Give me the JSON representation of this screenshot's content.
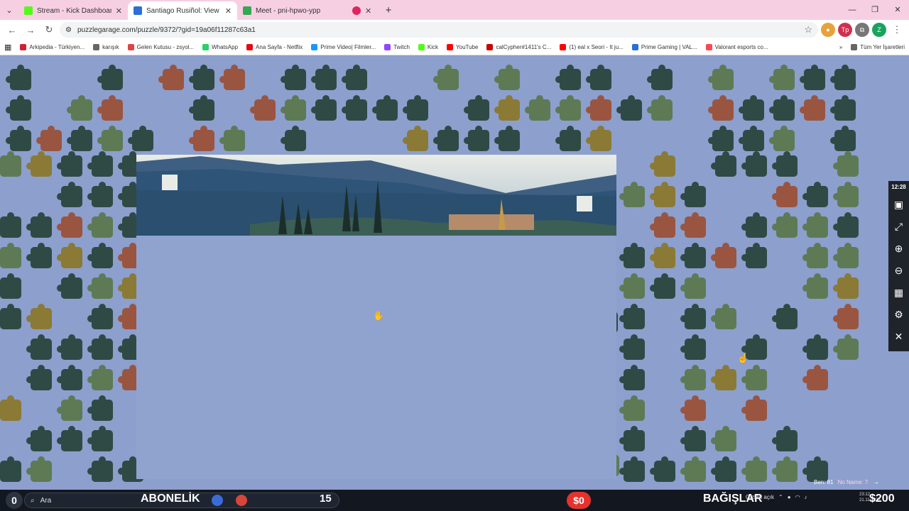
{
  "tabs": [
    {
      "label": "Stream - Kick Dashboard",
      "color": "#53fc18"
    },
    {
      "label": "Santiago Rusiñol: View Over So",
      "color": "#2b6fd6"
    },
    {
      "label": "Meet - pni-hpwo-ypp",
      "color": "#34a853"
    },
    {
      "label": "",
      "color": "#e0245e"
    }
  ],
  "address": {
    "url": "puzzlegarage.com/puzzle/9372/?gid=19a06f11287c63a1"
  },
  "bookmarks": [
    {
      "label": "Arkipedia - Türkiyen...",
      "color": "#c23"
    },
    {
      "label": "karışık",
      "color": "#666"
    },
    {
      "label": "Gelen Kutusu - zsyol...",
      "color": "#d44"
    },
    {
      "label": "WhatsApp",
      "color": "#25d366"
    },
    {
      "label": "Ana Sayfa - Netflix",
      "color": "#e50914"
    },
    {
      "label": "Prime Video| Filmler...",
      "color": "#1a98ff"
    },
    {
      "label": "Twitch",
      "color": "#9146ff"
    },
    {
      "label": "Kick",
      "color": "#53fc18"
    },
    {
      "label": "YouTube",
      "color": "#ff0000"
    },
    {
      "label": "calCypher#1411's C...",
      "color": "#c00"
    },
    {
      "label": "(1) eal x Seori - It ju...",
      "color": "#ff0000"
    },
    {
      "label": "Prime Gaming | VAL...",
      "color": "#2a6fd6"
    },
    {
      "label": "Valorant esports co...",
      "color": "#ff4655"
    }
  ],
  "bookmarks_right": {
    "label": "Tüm Yer İşaretleri"
  },
  "side_panel": {
    "time": "12:28",
    "buttons": [
      "image-icon",
      "fullscreen-icon",
      "zoom-in-icon",
      "zoom-out-icon",
      "grid-icon",
      "settings-icon",
      "close-icon"
    ]
  },
  "puzzle_stats": {
    "pieces_label": "Ben: 81",
    "name_label": "No Name: 7"
  },
  "taskbar": {
    "circle_count": "0",
    "search_placeholder": "Ara",
    "subscription_label": "ABONELİK",
    "subscription_count": "15",
    "money_pill": "$0",
    "donations_label": "BAĞIŞLAR",
    "tray_text": "Gizlilik açık",
    "clock_time": "23:12",
    "clock_date": "21.11.2025",
    "money_total": "$200"
  },
  "colors": {
    "board": "#8c9fcd",
    "piece_dark": "#2f4a45",
    "piece_light": "#5e7a55",
    "piece_red": "#9a5540",
    "piece_gold": "#8a7a35"
  }
}
